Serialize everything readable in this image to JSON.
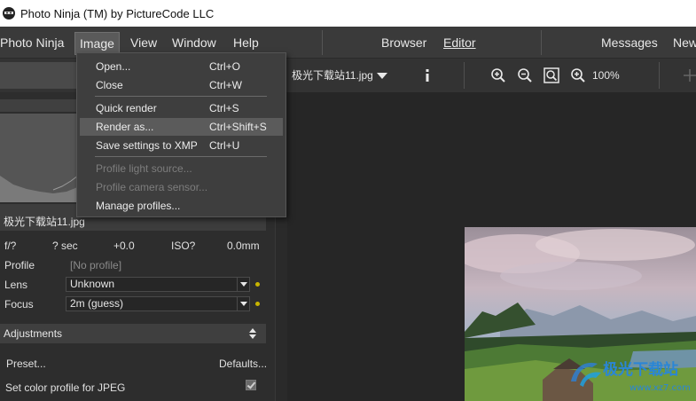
{
  "window": {
    "title": "Photo Ninja (TM) by PictureCode LLC"
  },
  "menubar": {
    "items": [
      "Photo Ninja",
      "Image",
      "View",
      "Window",
      "Help"
    ],
    "center_tabs": [
      "Browser",
      "Editor"
    ],
    "right_items": [
      "Messages",
      "New"
    ]
  },
  "toolbar": {
    "file_name": "极光下载站11.jpg",
    "zoom_level": "100%"
  },
  "image_menu": {
    "items": [
      {
        "label": "Open...",
        "shortcut": "Ctrl+O"
      },
      {
        "label": "Close",
        "shortcut": "Ctrl+W"
      },
      {
        "label": "Quick render",
        "shortcut": "Ctrl+S"
      },
      {
        "label": "Render as...",
        "shortcut": "Ctrl+Shift+S"
      },
      {
        "label": "Save settings to XMP",
        "shortcut": "Ctrl+U"
      },
      {
        "label": "Profile light source...",
        "shortcut": ""
      },
      {
        "label": "Profile camera sensor...",
        "shortcut": ""
      },
      {
        "label": "Manage profiles...",
        "shortcut": ""
      }
    ]
  },
  "left_panel": {
    "file_name": "极光下载站11.jpg",
    "exif": {
      "aperture": "f/?",
      "shutter": "? sec",
      "exposure": "+0.0",
      "iso": "ISO?",
      "focal": "0.0mm"
    },
    "profile": {
      "label": "Profile",
      "value": "[No profile]"
    },
    "lens": {
      "label": "Lens",
      "value": "Unknown"
    },
    "focus": {
      "label": "Focus",
      "value": "2m (guess)"
    },
    "adjustments": {
      "title": "Adjustments",
      "preset": "Preset...",
      "defaults": "Defaults...",
      "color_profile_label": "Set color profile for JPEG"
    }
  },
  "watermark": {
    "text": "极光下载站",
    "url": "www.xz7.com"
  },
  "colors": {
    "accent_dot": "#c8b400",
    "menu_hover": "#5b5b5b",
    "panel_bg": "#2d2d2d"
  }
}
